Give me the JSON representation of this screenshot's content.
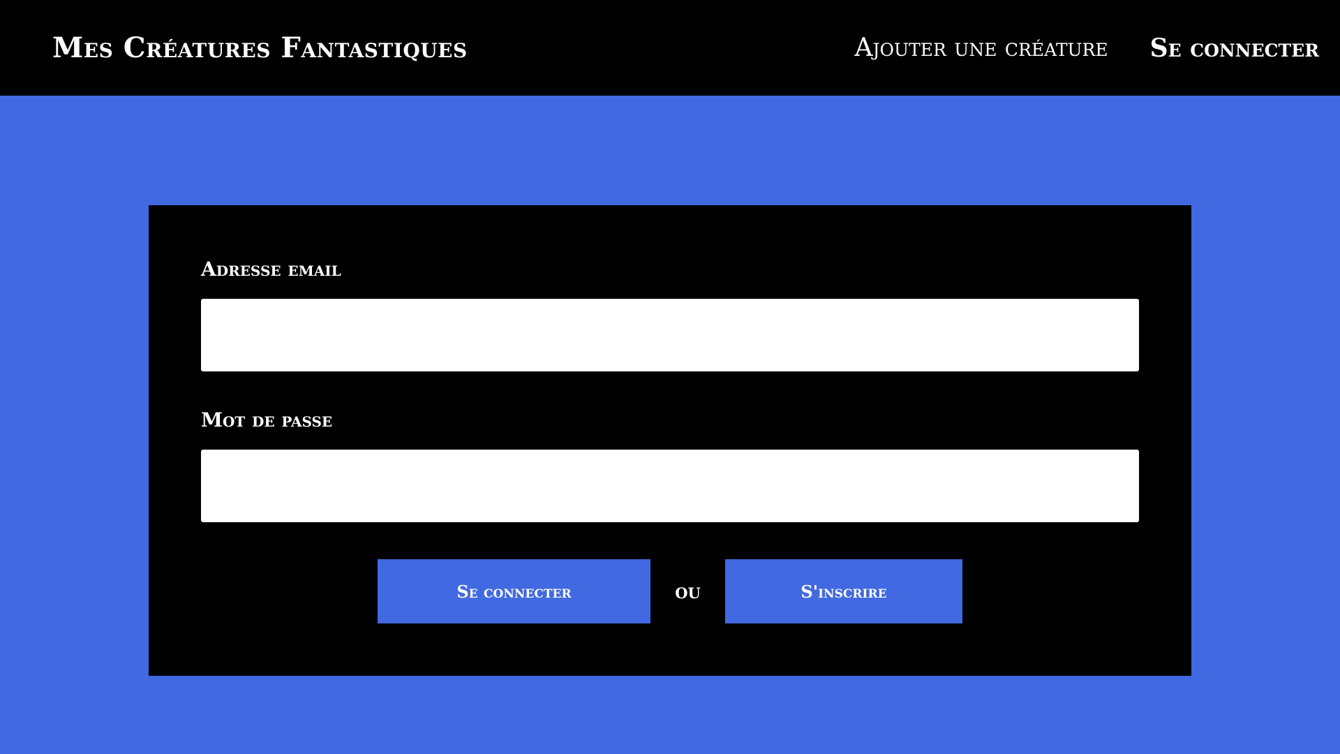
{
  "navbar": {
    "title": "Mes Créatures Fantastiques",
    "links": [
      {
        "label": "Ajouter une créature"
      },
      {
        "label": "Se connecter"
      }
    ]
  },
  "login_form": {
    "email_label": "Adresse email",
    "email_value": "",
    "password_label": "Mot de passe",
    "password_value": "",
    "login_button": "Se connecter",
    "separator": "ou",
    "signup_button": "S'inscrire"
  },
  "colors": {
    "background": "#4169e1",
    "navbar": "#000000",
    "card": "#000000",
    "button": "#4169e1",
    "text": "#ffffff"
  }
}
